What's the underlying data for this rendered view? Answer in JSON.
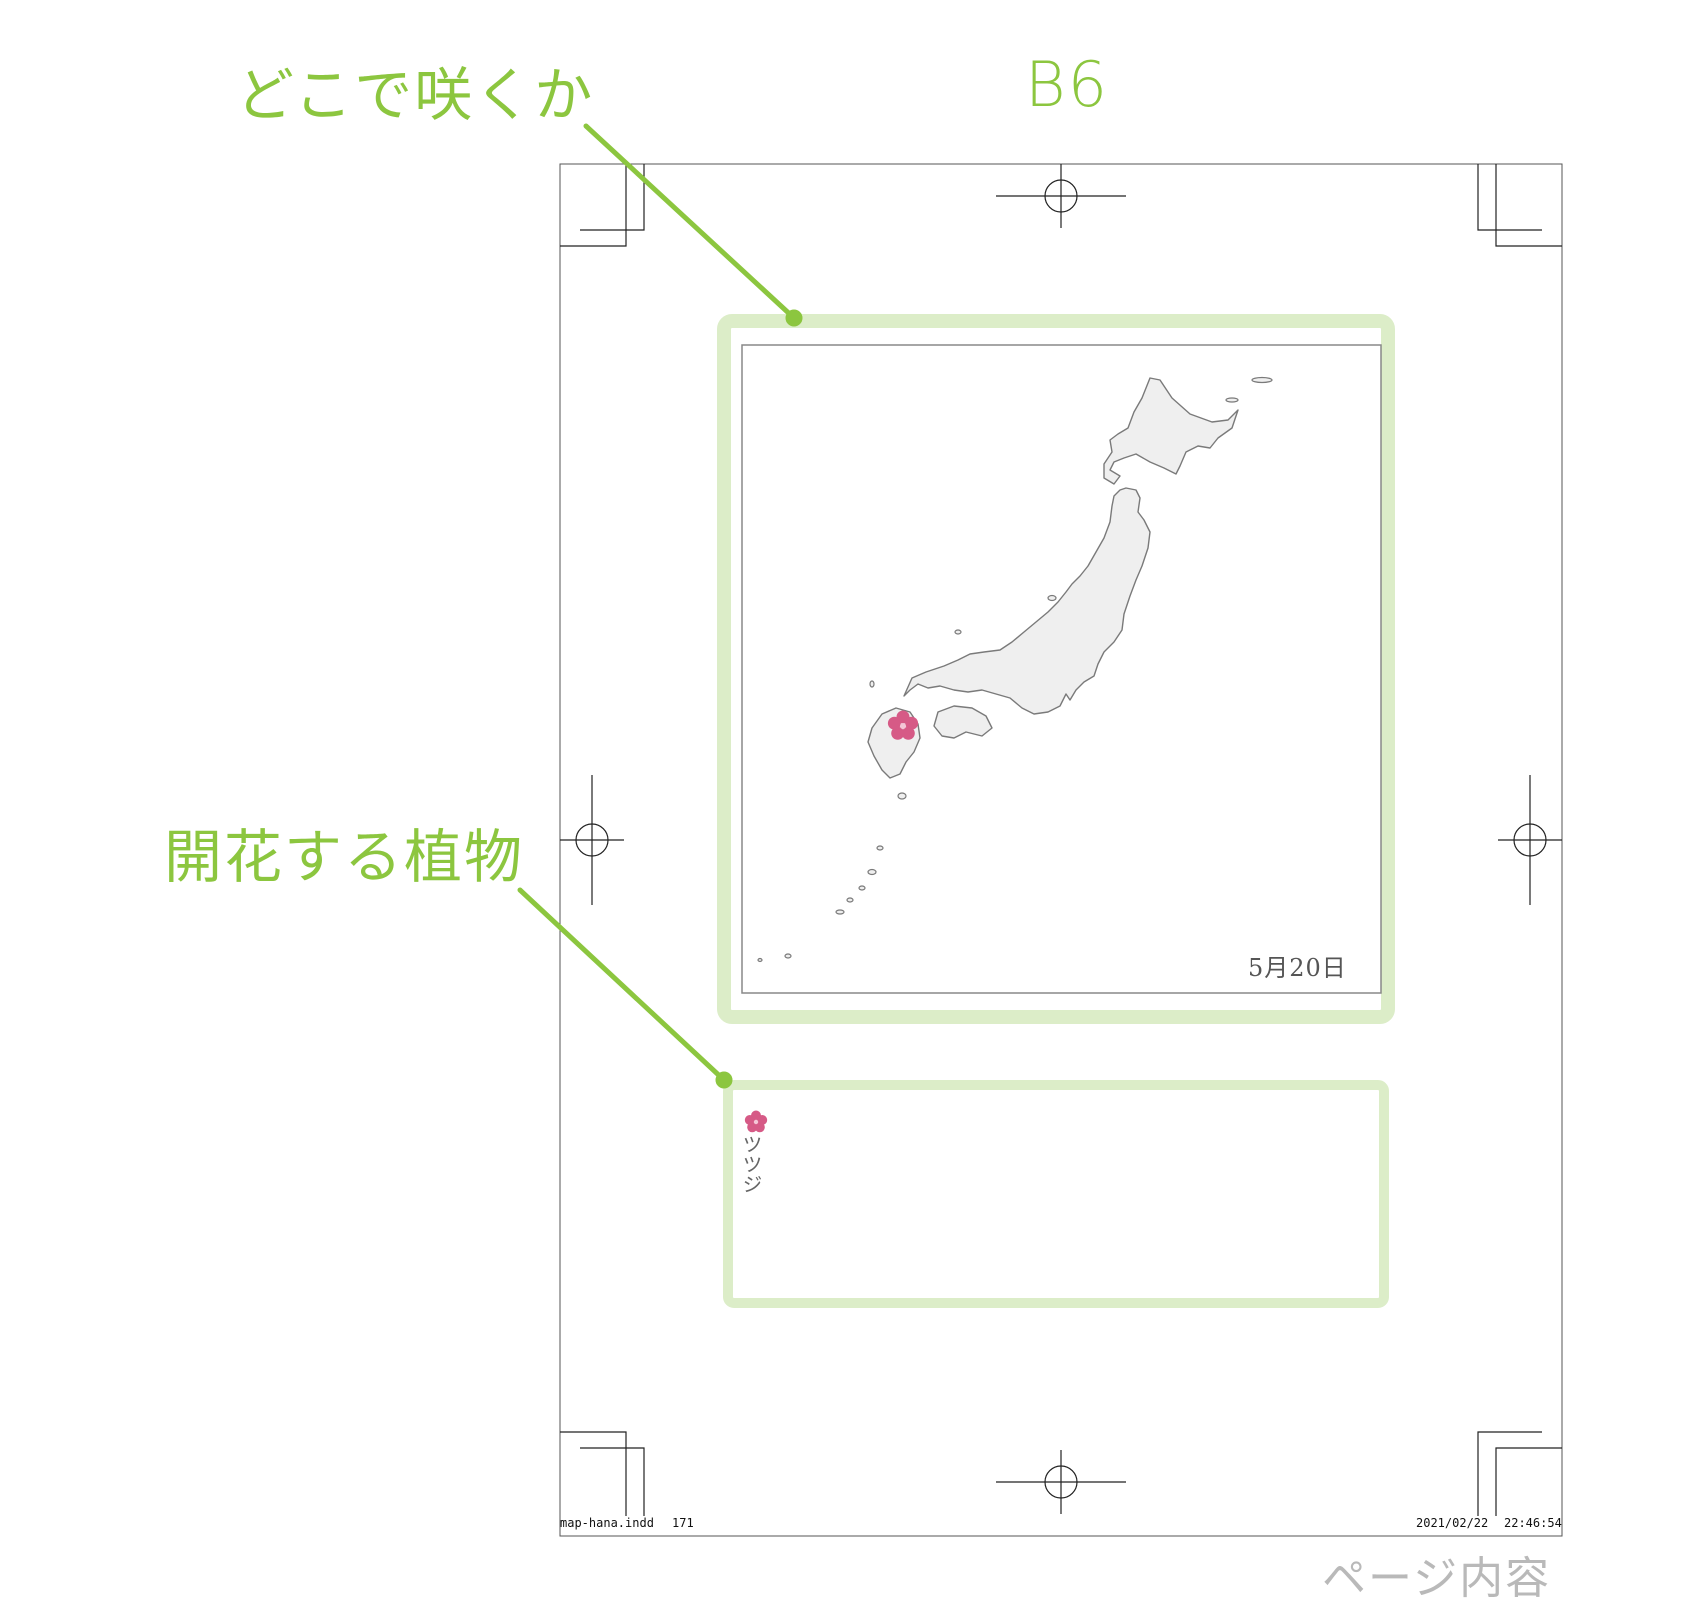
{
  "annotations": {
    "where_label": "どこで咲くか",
    "size_label": "B6",
    "plant_label": "開花する植物",
    "page_label": "ページ内容"
  },
  "map_panel": {
    "date": "5月20日",
    "marker_icon": "flower-icon",
    "marker_color": "#d65a86"
  },
  "plant_panel": {
    "icon": "flower-icon",
    "name": "ツツジ"
  },
  "slug": {
    "file": "map-hana.indd",
    "page": "171",
    "date": "2021/02/22",
    "time": "22:46:54"
  },
  "colors": {
    "accent_green": "#8cc63f",
    "frame_green": "#dcedc8",
    "flower_pink": "#d65a86"
  }
}
